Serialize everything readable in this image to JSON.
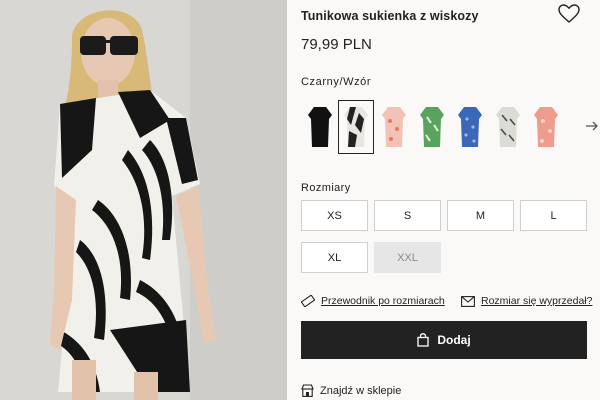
{
  "product": {
    "title": "Tunikowa sukienka z wiskozy",
    "price": "79,99 PLN",
    "image_alt": "model-in-zebra-print-dress"
  },
  "colors": {
    "selected_label": "Czarny/Wzór",
    "swatches": [
      {
        "name": "black",
        "fill": "#111111",
        "pattern": "#111111"
      },
      {
        "name": "black-white-print",
        "fill": "#e8e6e0",
        "pattern": "#222222"
      },
      {
        "name": "pink-print",
        "fill": "#f3c2b6",
        "pattern": "#e07a63"
      },
      {
        "name": "green-print",
        "fill": "#5aa35f",
        "pattern": "#eaf2e6"
      },
      {
        "name": "blue-print",
        "fill": "#3c66b7",
        "pattern": "#9fb8e4"
      },
      {
        "name": "grey-print",
        "fill": "#dcdcd6",
        "pattern": "#4a4a48"
      },
      {
        "name": "coral-print",
        "fill": "#ee9c8e",
        "pattern": "#f6d4cc"
      }
    ],
    "next_icon": "arrow-right-icon"
  },
  "sizes": {
    "label": "Rozmiary",
    "options": [
      {
        "label": "XS",
        "available": true
      },
      {
        "label": "S",
        "available": true
      },
      {
        "label": "M",
        "available": true
      },
      {
        "label": "L",
        "available": true
      },
      {
        "label": "XL",
        "available": true
      },
      {
        "label": "XXL",
        "available": false
      }
    ]
  },
  "links": {
    "size_guide": "Przewodnik po rozmiarach",
    "sold_out": "Rozmiar się wyprzedał?"
  },
  "cart": {
    "add_label": "Dodaj"
  },
  "store": {
    "label": "Znajdź w sklepie"
  },
  "theme": {
    "accent": "#222222",
    "background": "#faf9f8",
    "disabled_bg": "#e6e6e6"
  }
}
